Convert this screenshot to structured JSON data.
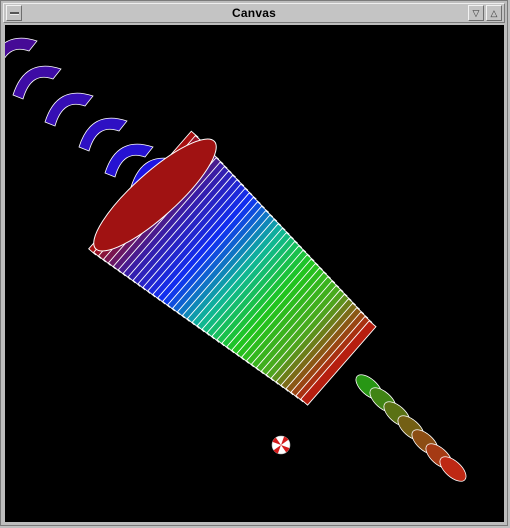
{
  "window": {
    "title": "Canvas",
    "menu_button_icon": "window-menu-icon",
    "minimize_icon": "minimize-triangle-icon",
    "minimize_glyph": "▽",
    "maximize_icon": "maximize-triangle-icon",
    "maximize_glyph": "△"
  },
  "scene": {
    "background": "#000000",
    "objects": [
      "coil-spring",
      "cone-body",
      "stem-coil",
      "small-disc"
    ],
    "color_ramp": [
      "#b01010",
      "#3a1fb0",
      "#1030ff",
      "#10c0a0",
      "#20d020",
      "#50b020",
      "#c02010"
    ]
  }
}
